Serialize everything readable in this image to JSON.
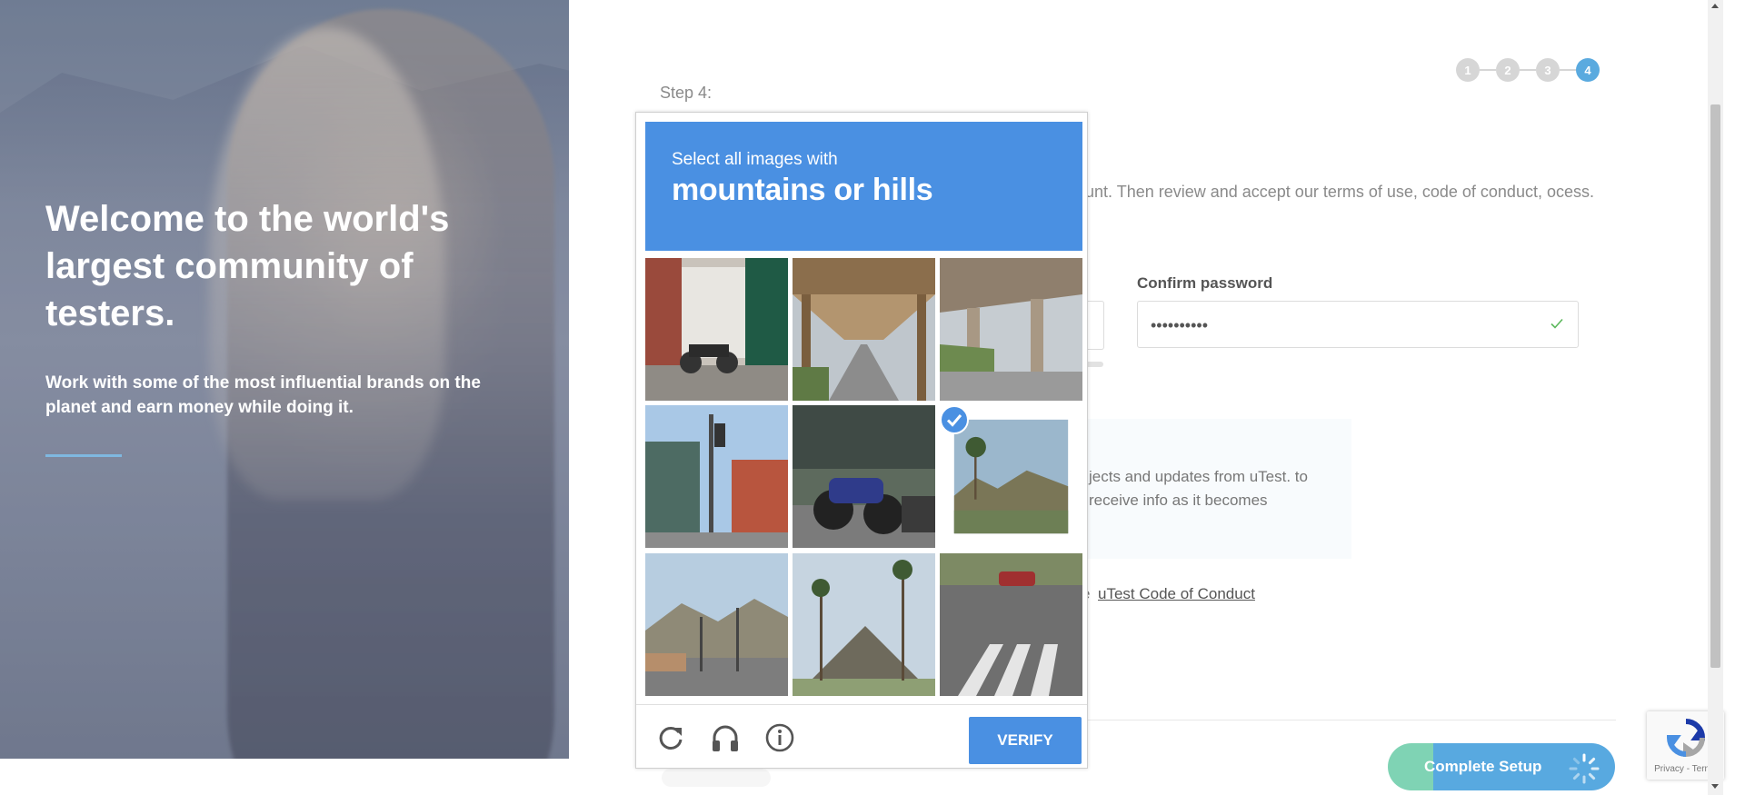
{
  "hero": {
    "title": "Welcome to the world's largest community of testers.",
    "subtitle": "Work with some of the most influential brands on the planet and earn money while doing it."
  },
  "stepper": {
    "steps": [
      "1",
      "2",
      "3",
      "4"
    ],
    "current": 4
  },
  "form": {
    "step_label": "Step 4:",
    "intro": "unt. Then review and accept our terms of use, code of conduct, ocess.",
    "confirm_password_label": "Confirm password",
    "confirm_password_value": "••••••••••",
    "info_text": "jects and updates from uTest. to receive info as it becomes",
    "coc_prefix": "e",
    "coc_link": "uTest Code of Conduct",
    "complete_button": "Complete Setup"
  },
  "captcha": {
    "instruction": "Select all images with",
    "target": "mountains or hills",
    "verify_label": "VERIFY",
    "tiles": [
      {
        "scene": "storefront-motorcycle",
        "selected": false
      },
      {
        "scene": "elevated-railway",
        "selected": false
      },
      {
        "scene": "overpass",
        "selected": false
      },
      {
        "scene": "traffic-light-building",
        "selected": false
      },
      {
        "scene": "parked-motorcycle",
        "selected": false
      },
      {
        "scene": "palm-hill",
        "selected": true
      },
      {
        "scene": "road-mountains",
        "selected": false
      },
      {
        "scene": "palm-mountain",
        "selected": false
      },
      {
        "scene": "crosswalk-street",
        "selected": false
      }
    ],
    "tools": [
      "reload-icon",
      "audio-headphones-icon",
      "info-icon"
    ]
  },
  "recaptcha_badge": {
    "links": "Privacy - Terms"
  },
  "colors": {
    "captcha_blue": "#4a90e2",
    "step_active": "#5aaadf",
    "step_inactive": "#d6d6d6",
    "button_green": "#7fd3b4",
    "button_blue": "#58a9e0",
    "check_green": "#5cb85c"
  }
}
